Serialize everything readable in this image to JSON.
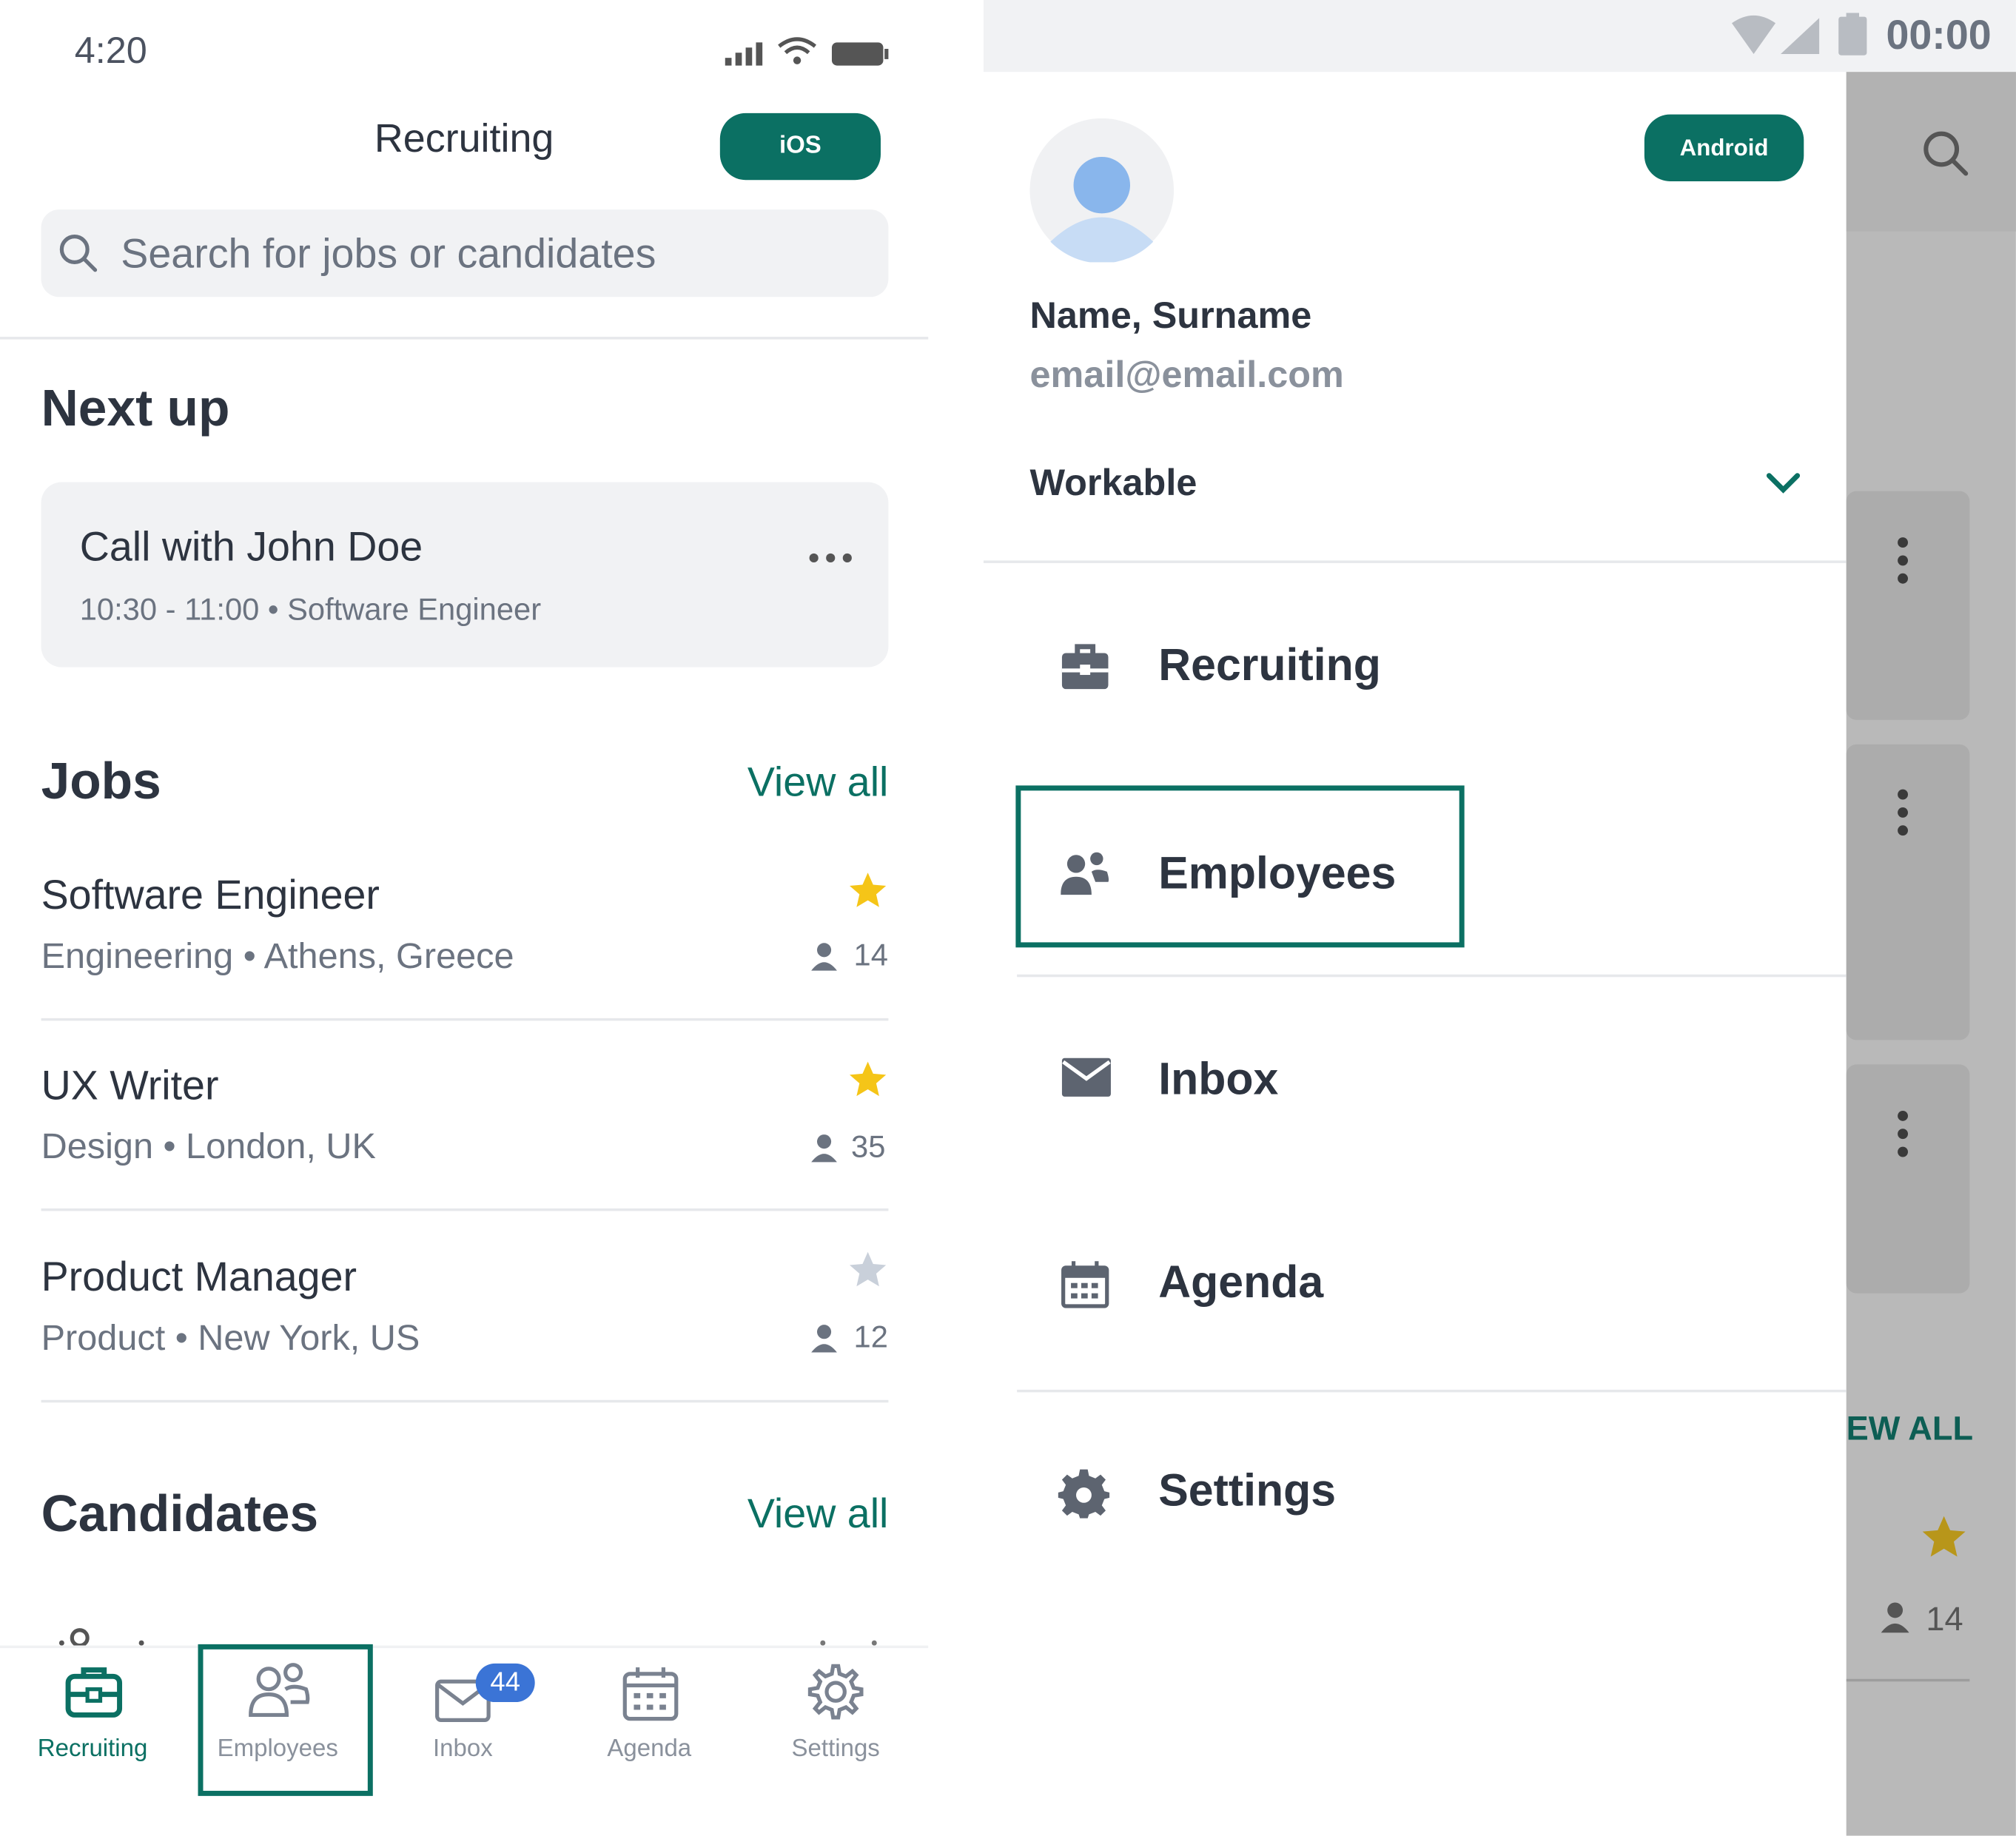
{
  "ios": {
    "status_time": "4:20",
    "title": "Recruiting",
    "badge": "iOS",
    "search_placeholder": "Search for jobs or candidates",
    "next_up": {
      "heading": "Next up",
      "event_title": "Call with John Doe",
      "event_details": "10:30 - 11:00 • Software Engineer"
    },
    "jobs": {
      "heading": "Jobs",
      "view_all": "View all",
      "items": [
        {
          "title": "Software Engineer",
          "meta": "Engineering • Athens, Greece",
          "count": "14",
          "starred": true
        },
        {
          "title": "UX Writer",
          "meta": "Design • London, UK",
          "count": "35",
          "starred": true
        },
        {
          "title": "Product Manager",
          "meta": "Product • New York, US",
          "count": "12",
          "starred": false
        }
      ]
    },
    "candidates": {
      "heading": "Candidates",
      "view_all": "View all"
    },
    "tabs": [
      {
        "label": "Recruiting",
        "icon": "briefcase-icon",
        "active": true
      },
      {
        "label": "Employees",
        "icon": "employees-icon",
        "active": false
      },
      {
        "label": "Inbox",
        "icon": "mail-icon",
        "badge": "44",
        "active": false
      },
      {
        "label": "Agenda",
        "icon": "calendar-icon",
        "active": false
      },
      {
        "label": "Settings",
        "icon": "gear-icon",
        "active": false
      }
    ]
  },
  "android": {
    "status_time": "00:00",
    "badge": "Android",
    "user": {
      "name": "Name, Surname",
      "email": "email@email.com"
    },
    "account": "Workable",
    "menu": [
      {
        "label": "Recruiting",
        "icon": "briefcase-icon"
      },
      {
        "label": "Employees",
        "icon": "employees-icon"
      },
      {
        "label": "Inbox",
        "icon": "mail-icon"
      },
      {
        "label": "Agenda",
        "icon": "calendar-icon"
      },
      {
        "label": "Settings",
        "icon": "gear-icon"
      }
    ],
    "background": {
      "view_all_fragment": "EW ALL",
      "count": "14"
    }
  },
  "colors": {
    "brand": "#0b7063",
    "star": "#f5c518",
    "badge_blue": "#3b74d6",
    "text": "#2d3440",
    "muted": "#6b7380"
  }
}
